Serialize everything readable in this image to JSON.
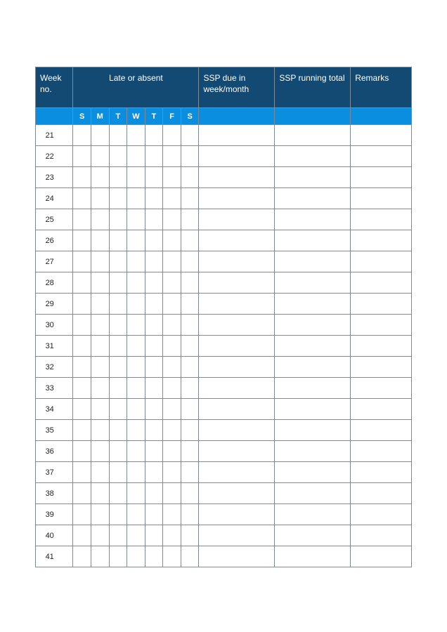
{
  "headers": {
    "week_no": "Week no.",
    "late_or_absent": "Late or absent",
    "ssp_due": "SSP due in week/month",
    "ssp_running": "SSP running total",
    "remarks": "Remarks"
  },
  "days": [
    "S",
    "M",
    "T",
    "W",
    "T",
    "F",
    "S"
  ],
  "rows": [
    {
      "week": "21",
      "d": [
        "",
        "",
        "",
        "",
        "",
        "",
        ""
      ],
      "ssp_due": "",
      "ssp_run": "",
      "remarks": ""
    },
    {
      "week": "22",
      "d": [
        "",
        "",
        "",
        "",
        "",
        "",
        ""
      ],
      "ssp_due": "",
      "ssp_run": "",
      "remarks": ""
    },
    {
      "week": "23",
      "d": [
        "",
        "",
        "",
        "",
        "",
        "",
        ""
      ],
      "ssp_due": "",
      "ssp_run": "",
      "remarks": ""
    },
    {
      "week": "24",
      "d": [
        "",
        "",
        "",
        "",
        "",
        "",
        ""
      ],
      "ssp_due": "",
      "ssp_run": "",
      "remarks": ""
    },
    {
      "week": "25",
      "d": [
        "",
        "",
        "",
        "",
        "",
        "",
        ""
      ],
      "ssp_due": "",
      "ssp_run": "",
      "remarks": ""
    },
    {
      "week": "26",
      "d": [
        "",
        "",
        "",
        "",
        "",
        "",
        ""
      ],
      "ssp_due": "",
      "ssp_run": "",
      "remarks": ""
    },
    {
      "week": "27",
      "d": [
        "",
        "",
        "",
        "",
        "",
        "",
        ""
      ],
      "ssp_due": "",
      "ssp_run": "",
      "remarks": ""
    },
    {
      "week": "28",
      "d": [
        "",
        "",
        "",
        "",
        "",
        "",
        ""
      ],
      "ssp_due": "",
      "ssp_run": "",
      "remarks": ""
    },
    {
      "week": "29",
      "d": [
        "",
        "",
        "",
        "",
        "",
        "",
        ""
      ],
      "ssp_due": "",
      "ssp_run": "",
      "remarks": ""
    },
    {
      "week": "30",
      "d": [
        "",
        "",
        "",
        "",
        "",
        "",
        ""
      ],
      "ssp_due": "",
      "ssp_run": "",
      "remarks": ""
    },
    {
      "week": "31",
      "d": [
        "",
        "",
        "",
        "",
        "",
        "",
        ""
      ],
      "ssp_due": "",
      "ssp_run": "",
      "remarks": ""
    },
    {
      "week": "32",
      "d": [
        "",
        "",
        "",
        "",
        "",
        "",
        ""
      ],
      "ssp_due": "",
      "ssp_run": "",
      "remarks": ""
    },
    {
      "week": "33",
      "d": [
        "",
        "",
        "",
        "",
        "",
        "",
        ""
      ],
      "ssp_due": "",
      "ssp_run": "",
      "remarks": ""
    },
    {
      "week": "34",
      "d": [
        "",
        "",
        "",
        "",
        "",
        "",
        ""
      ],
      "ssp_due": "",
      "ssp_run": "",
      "remarks": ""
    },
    {
      "week": "35",
      "d": [
        "",
        "",
        "",
        "",
        "",
        "",
        ""
      ],
      "ssp_due": "",
      "ssp_run": "",
      "remarks": ""
    },
    {
      "week": "36",
      "d": [
        "",
        "",
        "",
        "",
        "",
        "",
        ""
      ],
      "ssp_due": "",
      "ssp_run": "",
      "remarks": ""
    },
    {
      "week": "37",
      "d": [
        "",
        "",
        "",
        "",
        "",
        "",
        ""
      ],
      "ssp_due": "",
      "ssp_run": "",
      "remarks": ""
    },
    {
      "week": "38",
      "d": [
        "",
        "",
        "",
        "",
        "",
        "",
        ""
      ],
      "ssp_due": "",
      "ssp_run": "",
      "remarks": ""
    },
    {
      "week": "39",
      "d": [
        "",
        "",
        "",
        "",
        "",
        "",
        ""
      ],
      "ssp_due": "",
      "ssp_run": "",
      "remarks": ""
    },
    {
      "week": "40",
      "d": [
        "",
        "",
        "",
        "",
        "",
        "",
        ""
      ],
      "ssp_due": "",
      "ssp_run": "",
      "remarks": ""
    },
    {
      "week": "41",
      "d": [
        "",
        "",
        "",
        "",
        "",
        "",
        ""
      ],
      "ssp_due": "",
      "ssp_run": "",
      "remarks": ""
    }
  ]
}
